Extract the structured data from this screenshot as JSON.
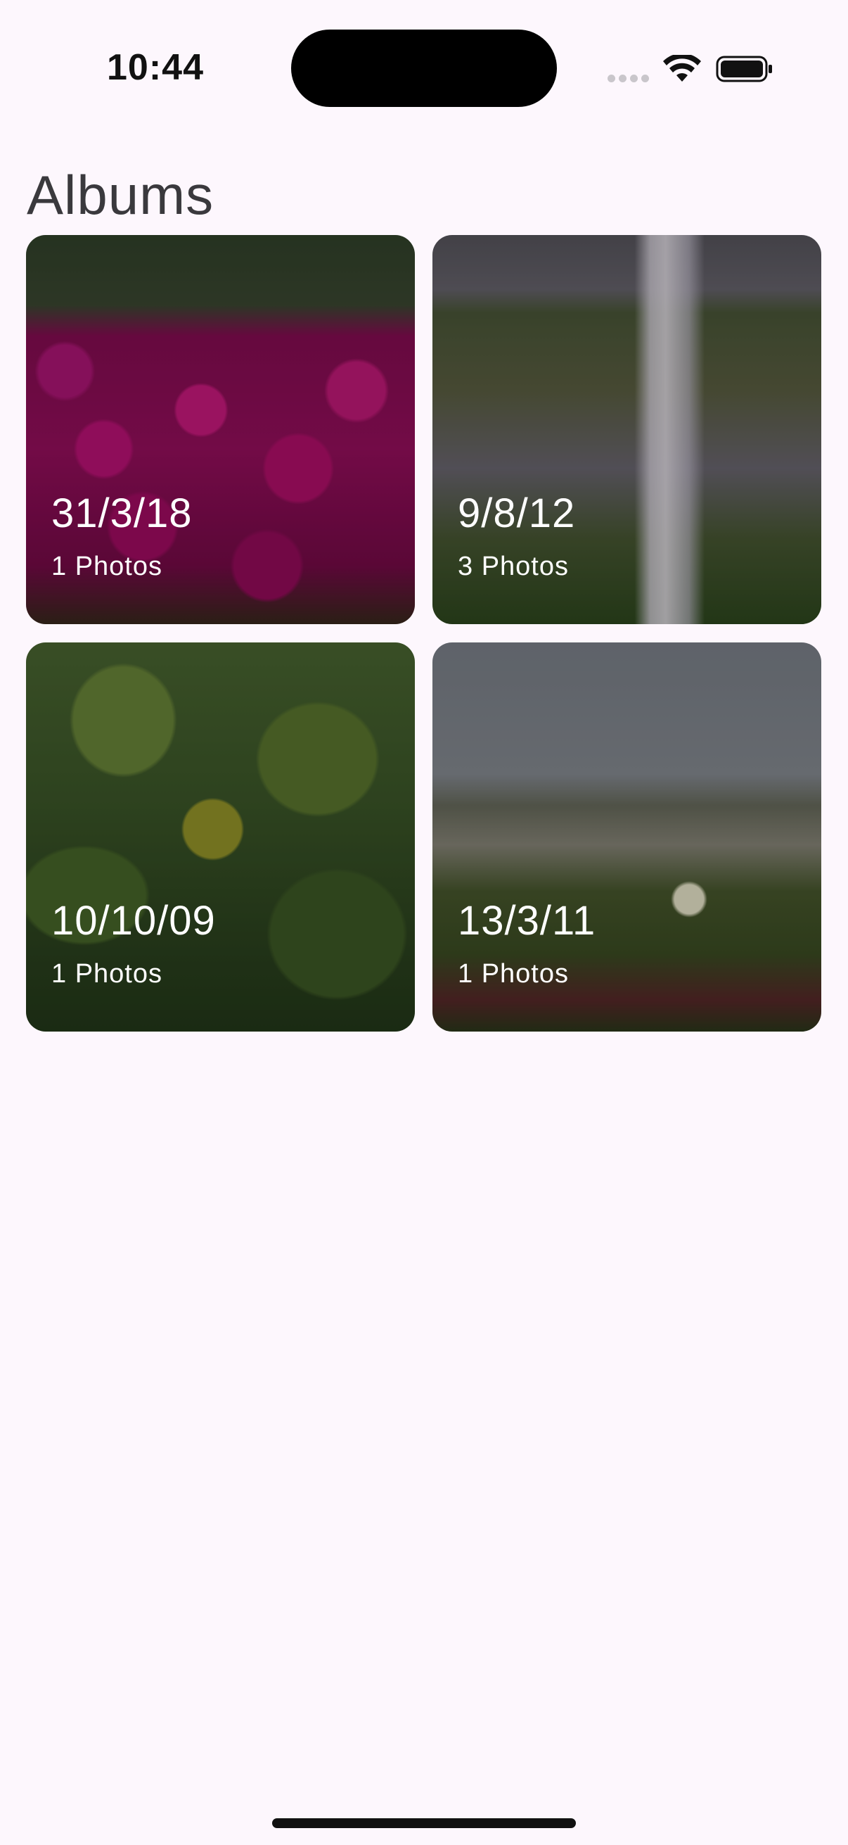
{
  "status_bar": {
    "time": "10:44",
    "icons": [
      "cellular-signal-icon",
      "wifi-icon",
      "battery-icon"
    ]
  },
  "header": {
    "title": "Albums"
  },
  "albums": [
    {
      "date": "31/3/18",
      "count": "1 Photos",
      "photo": "magenta-flowers"
    },
    {
      "date": "9/8/12",
      "count": "3 Photos",
      "photo": "waterfall-cliff"
    },
    {
      "date": "10/10/09",
      "count": "1 Photos",
      "photo": "green-leaves"
    },
    {
      "date": "13/3/11",
      "count": "1 Photos",
      "photo": "beach-grass-flower"
    }
  ],
  "colors": {
    "background": "#fdf7fd",
    "title": "#3a393d",
    "album_text": "#ffffff"
  }
}
